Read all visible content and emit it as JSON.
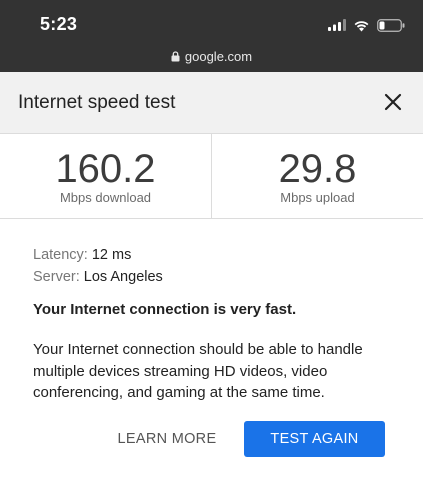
{
  "status_bar": {
    "time": "5:23",
    "icons": [
      "signal-icon",
      "wifi-icon",
      "battery-icon"
    ]
  },
  "browser": {
    "url": "google.com",
    "icon": "lock-icon"
  },
  "card": {
    "title": "Internet speed test",
    "close_icon": "close-icon"
  },
  "results": {
    "download": {
      "value": "160.2",
      "unit": "Mbps download"
    },
    "upload": {
      "value": "29.8",
      "unit": "Mbps upload"
    }
  },
  "details": {
    "latency_label": "Latency:",
    "latency_value": "12 ms",
    "server_label": "Server:",
    "server_value": "Los Angeles"
  },
  "summary": "Your Internet connection is very fast.",
  "description": "Your Internet connection should be able to handle multiple devices streaming HD videos, video conferencing, and gaming at the same time.",
  "actions": {
    "learn_more": "LEARN MORE",
    "test_again": "TEST AGAIN"
  },
  "colors": {
    "topbar": "#333333",
    "accent": "#1a73e8"
  }
}
